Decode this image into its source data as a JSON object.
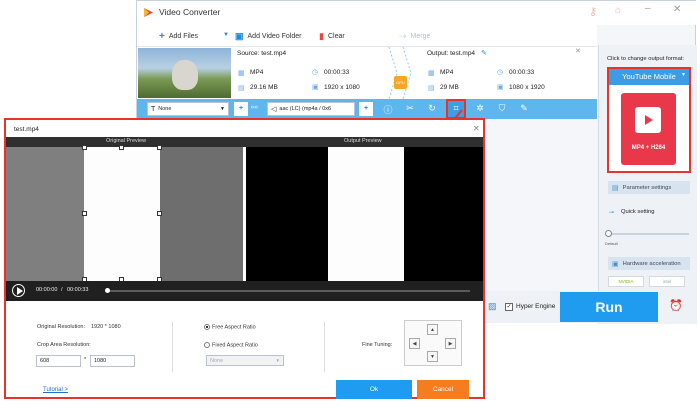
{
  "app": {
    "title": "Video Converter"
  },
  "toolbar": {
    "add_files": "Add Files",
    "add_folder": "Add Video Folder",
    "clear": "Clear",
    "merge": "Merge"
  },
  "source": {
    "label": "Source: test.mp4",
    "format": "MP4",
    "duration": "00:00:33",
    "size": "29.16 MB",
    "resolution": "1920 x 1080"
  },
  "output": {
    "label": "Output: test.mp4",
    "format": "MP4",
    "duration": "00:00:33",
    "size": "29 MB",
    "resolution": "1080 x 1920"
  },
  "gpu_label": "GPU",
  "edit_bar": {
    "subtitle": "None",
    "audio": "aac (LC) (mp4a / 0x6"
  },
  "right_panel": {
    "hint": "Click to change output format:",
    "format_name": "YouTube Mobile",
    "format_desc": "MP4 + H264",
    "param_settings": "Parameter settings",
    "quick_setting": "Quick setting",
    "default_label": "Default",
    "hw_accel": "Hardware acceleration",
    "nvidia": "NVIDIA",
    "intel": "intel"
  },
  "bottom": {
    "hyper_engine": "Hyper Engine",
    "run": "Run"
  },
  "dialog": {
    "title": "test.mp4",
    "original_preview": "Original Preview",
    "output_preview": "Output Preview",
    "time_current": "00:00:00",
    "time_sep": "/",
    "time_total": "00:00:33",
    "original_resolution_label": "Original Resolution:",
    "original_resolution_value": "1920 * 1080",
    "crop_area_label": "Crop Area Resolution:",
    "crop_width": "608",
    "crop_sep": "*",
    "crop_height": "1080",
    "free_aspect": "Free Aspect Ratio",
    "fixed_aspect": "Fixed Aspect Ratio",
    "aspect_select": "None",
    "fine_tuning": "Fine Tuning:",
    "tutorial": "Tutorial >",
    "ok": "Ok",
    "cancel": "Cancel"
  },
  "colors": {
    "accent_blue": "#1f9bf0",
    "cancel_orange": "#f57c1f",
    "highlight_red": "#e8332a",
    "format_red": "#e8384a"
  }
}
